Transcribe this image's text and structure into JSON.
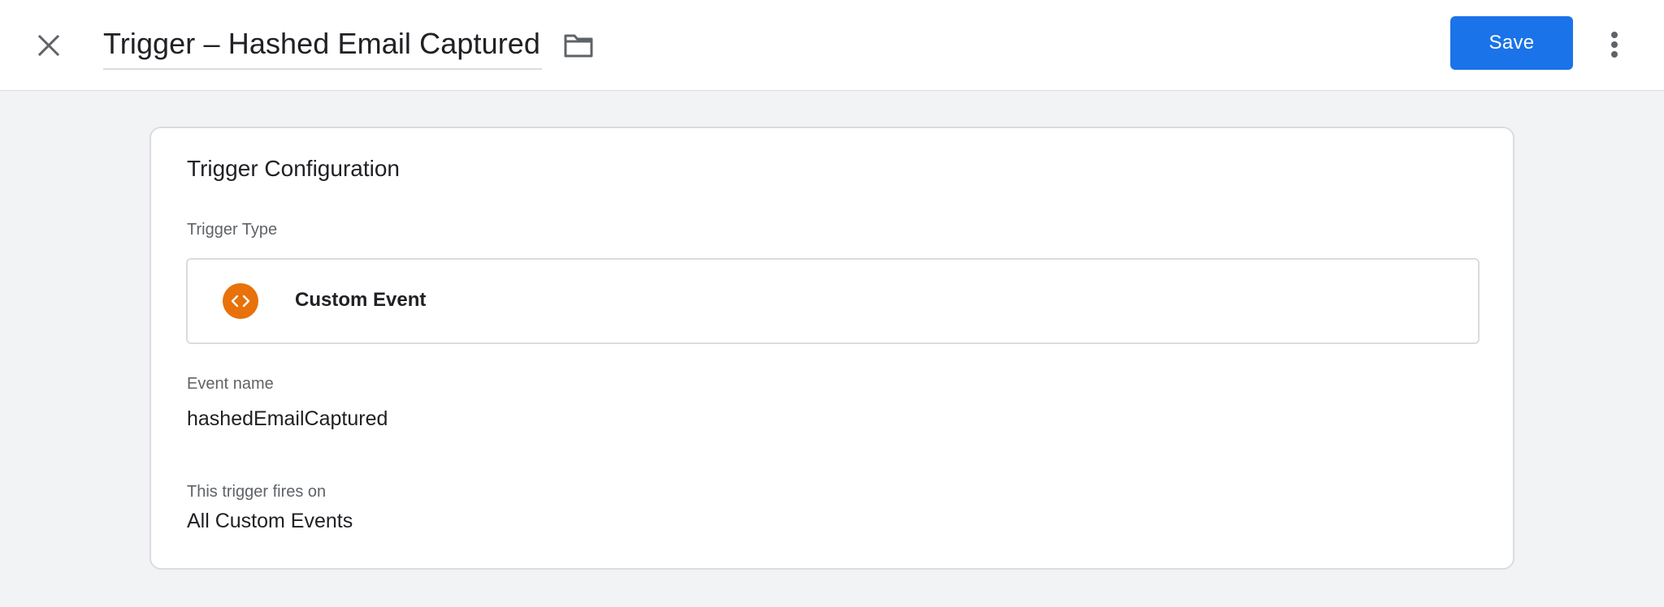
{
  "header": {
    "close_icon": "close-icon",
    "title": "Trigger – Hashed Email Captured",
    "folder_icon": "folder-icon",
    "save_label": "Save",
    "more_icon": "more-vert-icon",
    "save_color": "#1a73e8"
  },
  "card": {
    "title": "Trigger Configuration",
    "trigger_type": {
      "label": "Trigger Type",
      "value": "Custom Event",
      "icon": "code-brackets-icon",
      "icon_color": "#e8710a"
    },
    "event_name": {
      "label": "Event name",
      "value": "hashedEmailCaptured"
    },
    "fires_on": {
      "label": "This trigger fires on",
      "value": "All Custom Events"
    }
  }
}
